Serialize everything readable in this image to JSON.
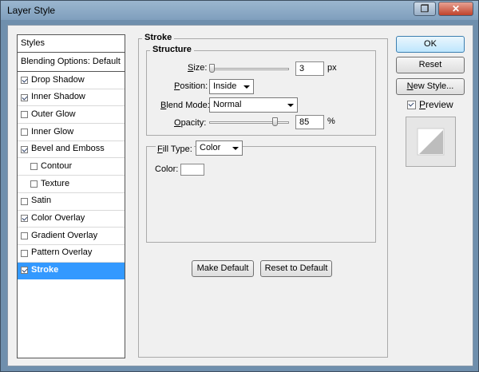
{
  "window": {
    "title": "Layer Style"
  },
  "styles_panel": {
    "header": "Styles",
    "blending_options": "Blending Options: Default",
    "items": [
      {
        "label": "Drop Shadow",
        "checked": true,
        "indent": false
      },
      {
        "label": "Inner Shadow",
        "checked": true,
        "indent": false
      },
      {
        "label": "Outer Glow",
        "checked": false,
        "indent": false
      },
      {
        "label": "Inner Glow",
        "checked": false,
        "indent": false
      },
      {
        "label": "Bevel and Emboss",
        "checked": true,
        "indent": false
      },
      {
        "label": "Contour",
        "checked": false,
        "indent": true
      },
      {
        "label": "Texture",
        "checked": false,
        "indent": true
      },
      {
        "label": "Satin",
        "checked": false,
        "indent": false
      },
      {
        "label": "Color Overlay",
        "checked": true,
        "indent": false
      },
      {
        "label": "Gradient Overlay",
        "checked": false,
        "indent": false
      },
      {
        "label": "Pattern Overlay",
        "checked": false,
        "indent": false
      },
      {
        "label": "Stroke",
        "checked": true,
        "indent": false,
        "selected": true
      }
    ]
  },
  "stroke": {
    "title": "Stroke",
    "structure_title": "Structure",
    "size_label": "Size:",
    "size_value": "3",
    "size_unit": "px",
    "size_slider_fraction": 0.0,
    "position_label": "Position:",
    "position_value": "Inside",
    "blend_mode_label": "Blend Mode:",
    "blend_mode_value": "Normal",
    "opacity_label": "Opacity:",
    "opacity_value": "85",
    "opacity_unit": "%",
    "opacity_slider_fraction": 0.85,
    "fill_type_label": "Fill Type:",
    "fill_type_value": "Color",
    "color_label": "Color:",
    "stroke_color": "#ffffff",
    "make_default": "Make Default",
    "reset_to_default": "Reset to Default"
  },
  "buttons": {
    "ok": "OK",
    "reset": "Reset",
    "new_style": "New Style...",
    "preview_label": "Preview",
    "preview_checked": true
  },
  "colors": {
    "selection": "#3399ff",
    "dialog_bg": "#f0f0f0",
    "title_bar": "#8eaac6",
    "close_button": "#c0422b"
  }
}
